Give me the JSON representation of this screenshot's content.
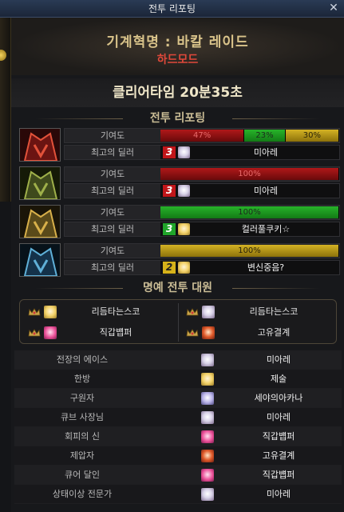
{
  "window": {
    "title": "전투 리포팅",
    "close_glyph": "✕"
  },
  "header": {
    "title": "기계혁명 : 바칼 레이드",
    "difficulty": "하드모드"
  },
  "clear_time": "클리어타임  20분35초",
  "reporting": {
    "section_title": "전투 리포팅",
    "contribution_label": "기여도",
    "top_dealer_label": "최고의 딜러",
    "rows": [
      {
        "portrait": "red-bakal-icon",
        "segments": [
          {
            "label": "47%",
            "value": 47,
            "color": "red"
          },
          {
            "label": "23%",
            "value": 23,
            "color": "green"
          },
          {
            "label": "30%",
            "value": 30,
            "color": "gold"
          }
        ],
        "rank": "3",
        "rank_color": "red",
        "face": "white",
        "dealer": "미아레"
      },
      {
        "portrait": "green-bakal-icon",
        "segments": [
          {
            "label": "100%",
            "value": 100,
            "color": "red"
          }
        ],
        "rank": "3",
        "rank_color": "red",
        "face": "white",
        "dealer": "미아레"
      },
      {
        "portrait": "gold-bakal-icon",
        "segments": [
          {
            "label": "100%",
            "value": 100,
            "color": "green"
          }
        ],
        "rank": "3",
        "rank_color": "green",
        "face": "blonde",
        "dealer": "컬러풀쿠키☆"
      },
      {
        "portrait": "blue-bakal-icon",
        "segments": [
          {
            "label": "100%",
            "value": 100,
            "color": "gold"
          }
        ],
        "rank": "2",
        "rank_color": "yellow",
        "face": "blonde",
        "dealer": "변신중음?"
      }
    ]
  },
  "honor": {
    "section_title": "명예 전투 대원",
    "members": [
      {
        "face": "blonde",
        "name": "리듬타는스코"
      },
      {
        "face": "white",
        "name": "리듬타는스코"
      },
      {
        "face": "pink",
        "name": "직갑뱹퍼"
      },
      {
        "face": "red",
        "name": "고유결계"
      }
    ]
  },
  "awards": [
    {
      "title": "전장의 에이스",
      "face": "white",
      "name": "미아레"
    },
    {
      "title": "한방",
      "face": "blonde",
      "name": "제술"
    },
    {
      "title": "구원자",
      "face": "lav",
      "name": "세야의아카나"
    },
    {
      "title": "큐브 사장님",
      "face": "white",
      "name": "미아레"
    },
    {
      "title": "회피의 신",
      "face": "pink",
      "name": "직갑뱹퍼"
    },
    {
      "title": "제압자",
      "face": "red",
      "name": "고유결계"
    },
    {
      "title": "큐어 달인",
      "face": "pink",
      "name": "직갑뱹퍼"
    },
    {
      "title": "상태이상 전문가",
      "face": "white",
      "name": "미아레"
    }
  ]
}
